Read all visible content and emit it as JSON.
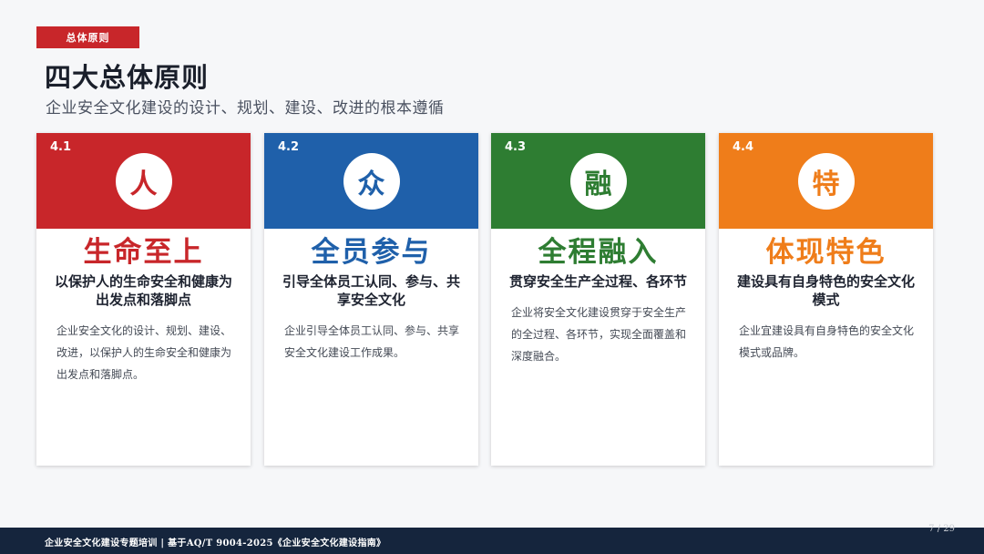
{
  "header": {
    "section_tag": "总体原则",
    "title": "四大总体原则",
    "subtitle": "企业安全文化建设的设计、规划、建设、改进的根本遵循"
  },
  "cards": [
    {
      "number": "4.1",
      "glyph": "人",
      "heading": "生命至上",
      "subheading": "以保护人的生命安全和健康为出发点和落脚点",
      "description": "企业安全文化的设计、规划、建设、改进，以保护人的生命安全和健康为出发点和落脚点。",
      "color": "#c8262a"
    },
    {
      "number": "4.2",
      "glyph": "众",
      "heading": "全员参与",
      "subheading": "引导全体员工认同、参与、共享安全文化",
      "description": "企业引导全体员工认同、参与、共享安全文化建设工作成果。",
      "color": "#1f60aa"
    },
    {
      "number": "4.3",
      "glyph": "融",
      "heading": "全程融入",
      "subheading": "贯穿安全生产全过程、各环节",
      "description": "企业将安全文化建设贯穿于安全生产的全过程、各环节，实现全面覆盖和深度融合。",
      "color": "#2e7d32"
    },
    {
      "number": "4.4",
      "glyph": "特",
      "heading": "体现特色",
      "subheading": "建设具有自身特色的安全文化模式",
      "description": "企业宜建设具有自身特色的安全文化模式或品牌。",
      "color": "#ef7d1a"
    }
  ],
  "footer": {
    "text": "企业安全文化建设专题培训 | 基于AQ/T 9004-2025《企业安全文化建设指南》",
    "page_number": "7 / 29"
  },
  "colors": {
    "accent_red": "#c8262a",
    "footer_bg": "#15253d"
  }
}
